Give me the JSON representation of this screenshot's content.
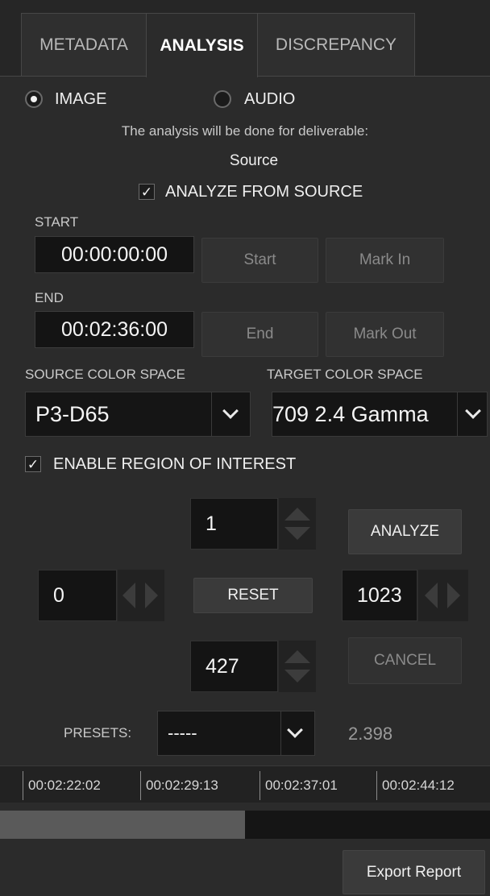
{
  "tabs": [
    {
      "label": "METADATA",
      "active": false
    },
    {
      "label": "ANALYSIS",
      "active": true
    },
    {
      "label": "DISCREPANCY",
      "active": false
    }
  ],
  "media_type": {
    "image_label": "IMAGE",
    "audio_label": "AUDIO",
    "selected": "IMAGE"
  },
  "deliverable": {
    "description": "The analysis will be done for deliverable:",
    "name": "Source"
  },
  "analyze_from_source": {
    "label": "ANALYZE FROM SOURCE",
    "checked": true
  },
  "start": {
    "label": "START",
    "timecode": "00:00:00:00",
    "start_button": "Start",
    "mark_in_button": "Mark In"
  },
  "end": {
    "label": "END",
    "timecode": "00:02:36:00",
    "end_button": "End",
    "mark_out_button": "Mark Out"
  },
  "color_space": {
    "source_label": "SOURCE COLOR SPACE",
    "source_value": "P3-D65",
    "target_label": "TARGET COLOR SPACE",
    "target_value": "709 2.4 Gamma"
  },
  "roi": {
    "enable_label": "ENABLE REGION OF INTEREST",
    "checked": true,
    "top": "1",
    "left": "0",
    "right": "1023",
    "bottom": "427",
    "reset_label": "RESET",
    "analyze_label": "ANALYZE",
    "cancel_label": "CANCEL"
  },
  "presets": {
    "label": "PRESETS:",
    "value": "-----",
    "frame_rate": "2.398"
  },
  "timeline": {
    "ticks": [
      "00:02:22:02",
      "00:02:29:13",
      "00:02:37:01",
      "00:02:44:12"
    ],
    "progress": 0.5
  },
  "footer": {
    "export_label": "Export Report"
  },
  "colors": {
    "background": "#2b2b2b",
    "field": "#141414",
    "text": "#e6e6e6"
  }
}
